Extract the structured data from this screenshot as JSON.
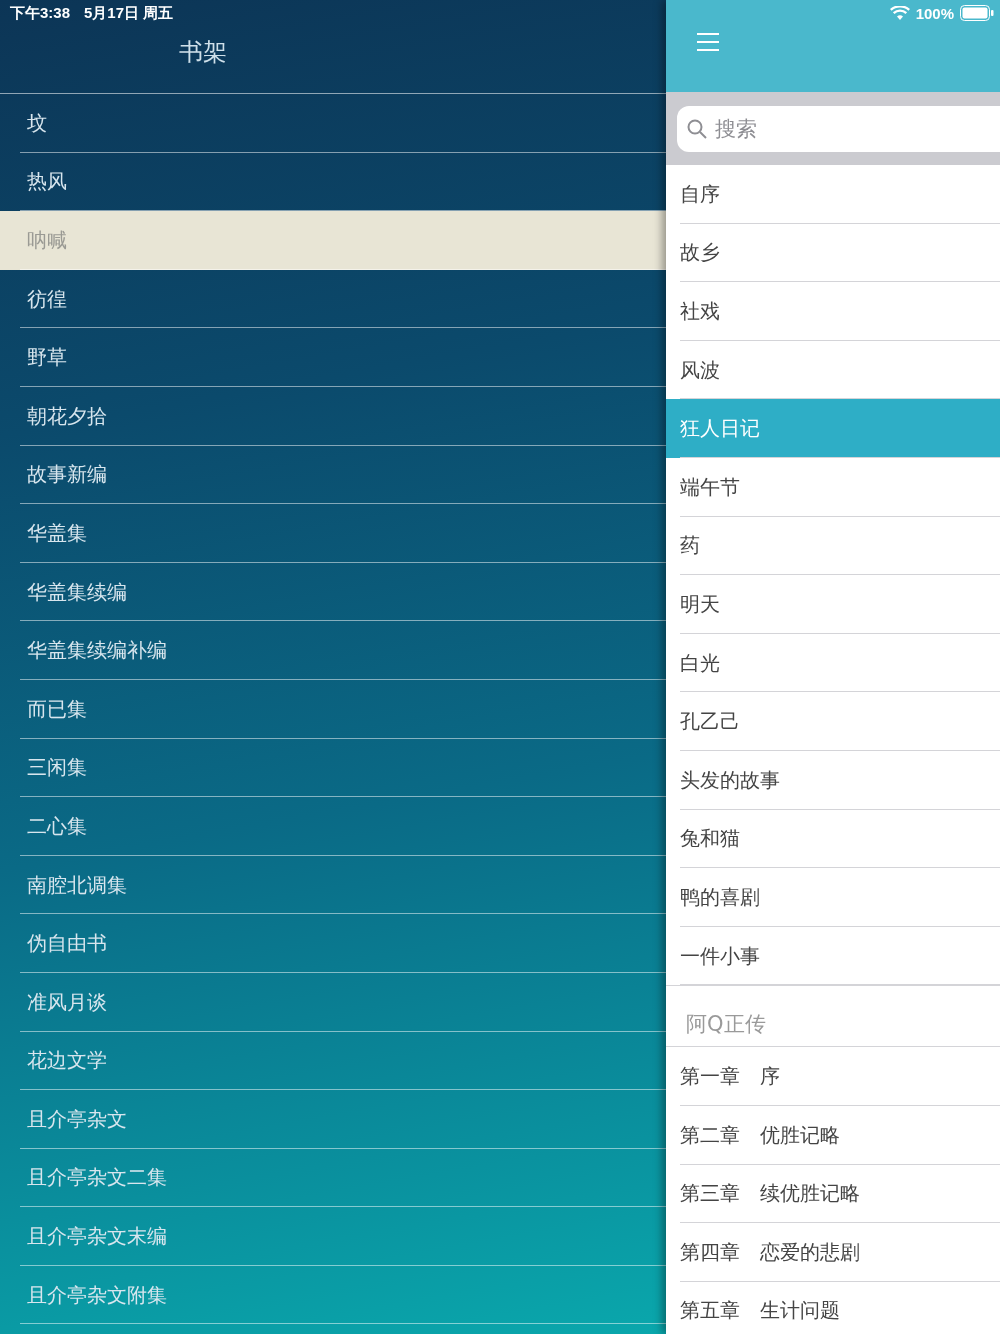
{
  "status_bar": {
    "time": "下午3:38",
    "date": "5月17日 周五",
    "battery_text": "100%"
  },
  "shelf": {
    "title": "书架",
    "books": [
      {
        "title": "坟",
        "selected": false
      },
      {
        "title": "热风",
        "selected": false
      },
      {
        "title": "呐喊",
        "selected": true
      },
      {
        "title": "彷徨",
        "selected": false
      },
      {
        "title": "野草",
        "selected": false
      },
      {
        "title": "朝花夕拾",
        "selected": false
      },
      {
        "title": "故事新编",
        "selected": false
      },
      {
        "title": "华盖集",
        "selected": false
      },
      {
        "title": "华盖集续编",
        "selected": false
      },
      {
        "title": "华盖集续编补编",
        "selected": false
      },
      {
        "title": "而已集",
        "selected": false
      },
      {
        "title": "三闲集",
        "selected": false
      },
      {
        "title": "二心集",
        "selected": false
      },
      {
        "title": "南腔北调集",
        "selected": false
      },
      {
        "title": "伪自由书",
        "selected": false
      },
      {
        "title": "准风月谈",
        "selected": false
      },
      {
        "title": "花边文学",
        "selected": false
      },
      {
        "title": "且介亭杂文",
        "selected": false
      },
      {
        "title": "且介亭杂文二集",
        "selected": false
      },
      {
        "title": "且介亭杂文末编",
        "selected": false
      },
      {
        "title": "且介亭杂文附集",
        "selected": false
      }
    ]
  },
  "contents": {
    "search": {
      "placeholder": "搜索"
    },
    "sections": [
      {
        "items": [
          {
            "title": "自序",
            "selected": false
          },
          {
            "title": "故乡",
            "selected": false
          },
          {
            "title": "社戏",
            "selected": false
          },
          {
            "title": "风波",
            "selected": false
          },
          {
            "title": "狂人日记",
            "selected": true
          },
          {
            "title": "端午节",
            "selected": false
          },
          {
            "title": "药",
            "selected": false
          },
          {
            "title": "明天",
            "selected": false
          },
          {
            "title": "白光",
            "selected": false
          },
          {
            "title": "孔乙己",
            "selected": false
          },
          {
            "title": "头发的故事",
            "selected": false
          },
          {
            "title": "兔和猫",
            "selected": false
          },
          {
            "title": "鸭的喜剧",
            "selected": false
          },
          {
            "title": "一件小事",
            "selected": false
          }
        ]
      },
      {
        "header": "阿Q正传",
        "items": [
          {
            "title": "第一章　序",
            "selected": false
          },
          {
            "title": "第二章　优胜记略",
            "selected": false
          },
          {
            "title": "第三章　续优胜记略",
            "selected": false
          },
          {
            "title": "第四章　恋爱的悲剧",
            "selected": false
          },
          {
            "title": "第五章　生计问题",
            "selected": false
          }
        ]
      }
    ]
  }
}
